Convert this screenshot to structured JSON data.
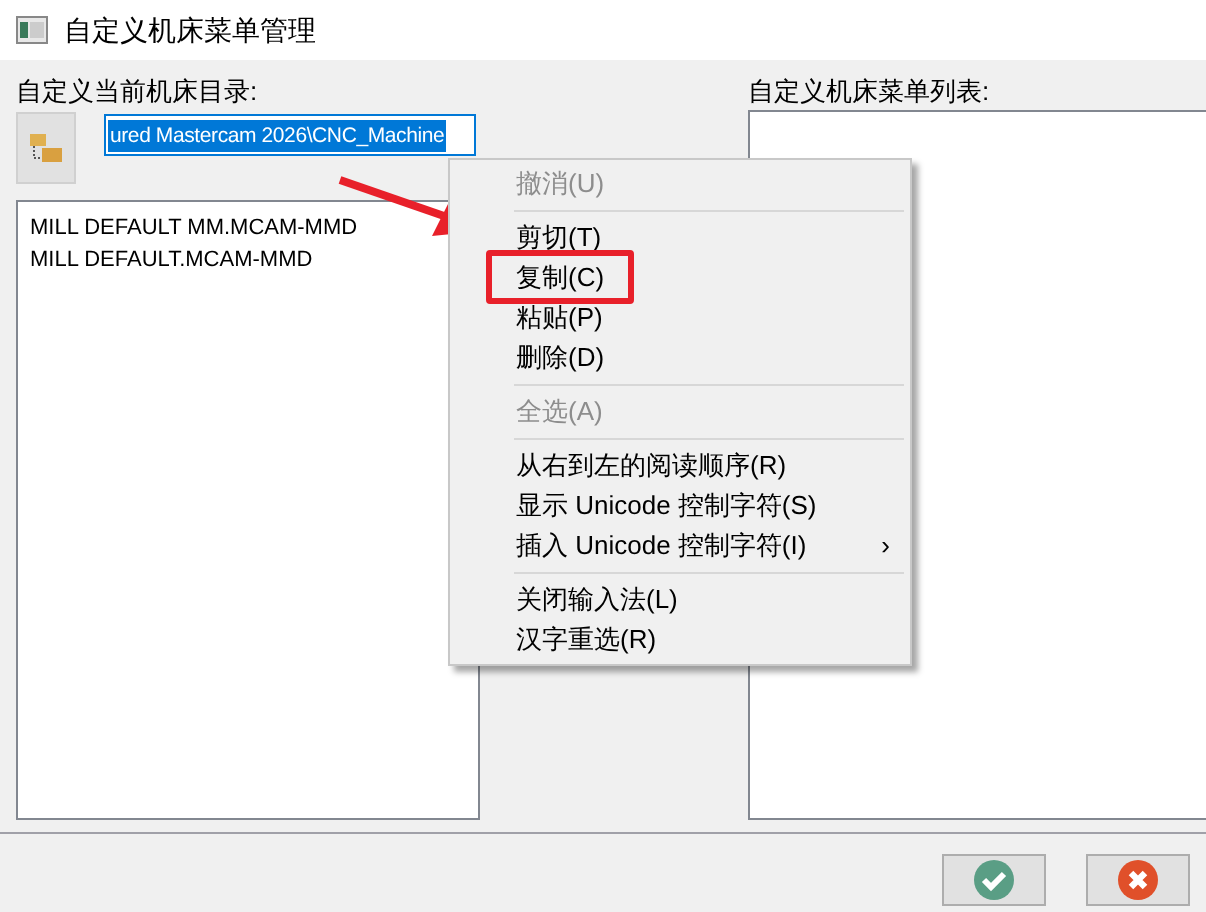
{
  "window": {
    "title": "自定义机床菜单管理"
  },
  "left": {
    "label": "自定义当前机床目录:",
    "path_field": {
      "value": "ured Mastercam 2026\\CNC_Machine",
      "selected": true
    },
    "list": [
      "MILL DEFAULT MM.MCAM-MMD",
      "MILL DEFAULT.MCAM-MMD"
    ]
  },
  "right": {
    "label": "自定义机床菜单列表:"
  },
  "context_menu": [
    {
      "kind": "item",
      "label": "撤消(U)",
      "disabled": true,
      "highlighted": false,
      "submenu": false
    },
    {
      "kind": "separator"
    },
    {
      "kind": "item",
      "label": "剪切(T)",
      "disabled": false,
      "highlighted": false,
      "submenu": false
    },
    {
      "kind": "item",
      "label": "复制(C)",
      "disabled": false,
      "highlighted": true,
      "submenu": false
    },
    {
      "kind": "item",
      "label": "粘贴(P)",
      "disabled": false,
      "highlighted": false,
      "submenu": false
    },
    {
      "kind": "item",
      "label": "删除(D)",
      "disabled": false,
      "highlighted": false,
      "submenu": false
    },
    {
      "kind": "separator"
    },
    {
      "kind": "item",
      "label": "全选(A)",
      "disabled": true,
      "highlighted": false,
      "submenu": false
    },
    {
      "kind": "separator"
    },
    {
      "kind": "item",
      "label": "从右到左的阅读顺序(R)",
      "disabled": false,
      "highlighted": false,
      "submenu": false
    },
    {
      "kind": "item",
      "label": "显示 Unicode 控制字符(S)",
      "disabled": false,
      "highlighted": false,
      "submenu": false
    },
    {
      "kind": "item",
      "label": "插入 Unicode 控制字符(I)",
      "disabled": false,
      "highlighted": false,
      "submenu": true,
      "submenu_mark": "›"
    },
    {
      "kind": "separator"
    },
    {
      "kind": "item",
      "label": "关闭输入法(L)",
      "disabled": false,
      "highlighted": false,
      "submenu": false
    },
    {
      "kind": "item",
      "label": "汉字重选(R)",
      "disabled": false,
      "highlighted": false,
      "submenu": false
    }
  ]
}
